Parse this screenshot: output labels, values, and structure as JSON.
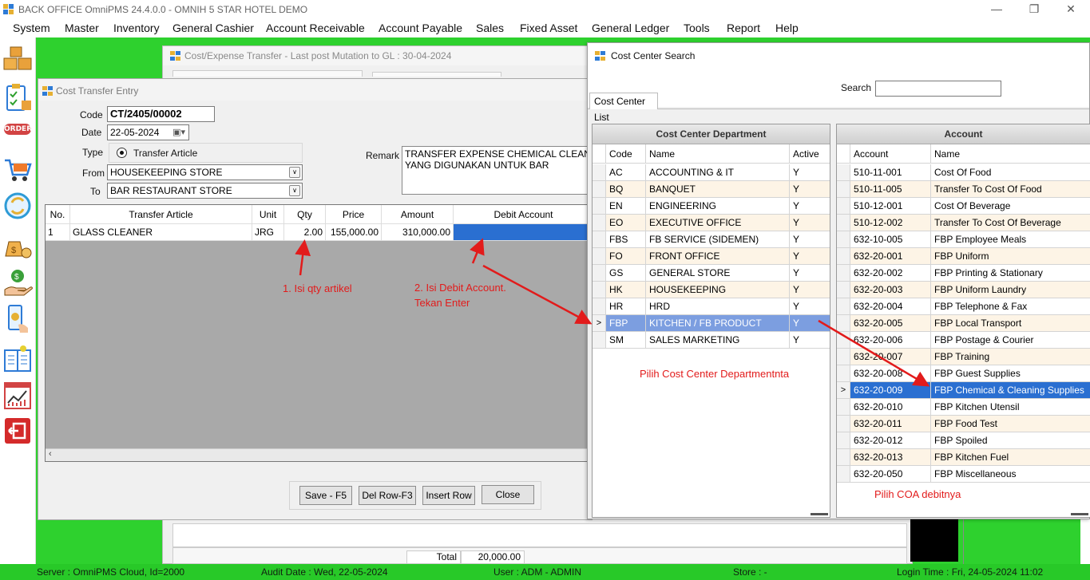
{
  "app": {
    "title": "BACK OFFICE OmniPMS 24.4.0.0 - OMNIH 5 STAR HOTEL DEMO",
    "window_buttons": [
      "—",
      "❐",
      "✕"
    ]
  },
  "menu": [
    "System",
    "Master",
    "Inventory",
    "General Cashier",
    "Account Receivable",
    "Account Payable",
    "Sales",
    "Fixed Asset",
    "General Ledger",
    "Tools",
    "Report",
    "Help"
  ],
  "sidebar_icons": [
    "boxes-icon",
    "clipboard-icon",
    "order-icon",
    "cart-icon",
    "refresh-icon",
    "money-bags-icon",
    "hand-money-icon",
    "mobile-payment-icon",
    "ledger-book-icon",
    "chart-icon",
    "exit-icon"
  ],
  "sidebar_order_label": "ORDER",
  "back_window": {
    "title": "Cost/Expense Transfer - Last post Mutation to GL : 30-04-2024",
    "total_label": "Total",
    "total_value": "20,000.00"
  },
  "entry": {
    "title": "Cost Transfer Entry",
    "code_label": "Code",
    "code_value": "CT/2405/00002",
    "date_label": "Date",
    "date_value": "22-05-2024",
    "type_label": "Type",
    "type_value": "Transfer Article",
    "from_label": "From",
    "from_value": "HOUSEKEEPING STORE",
    "to_label": "To",
    "to_value": "BAR RESTAURANT STORE",
    "remark_label": "Remark",
    "remark_line1": "TRANSFER EXPENSE CHEMICAL CLEANER D",
    "remark_line2": "YANG DIGUNAKAN UNTUK BAR",
    "grid_headers": [
      "No.",
      "Transfer Article",
      "Unit",
      "Qty",
      "Price",
      "Amount",
      "Debit Account"
    ],
    "grid_rows": [
      {
        "no": "1",
        "article": "GLASS CLEANER",
        "unit": "JRG",
        "qty": "2.00",
        "price": "155,000.00",
        "amount": "310,000.00",
        "debit": ""
      }
    ],
    "buttons": {
      "save": "Save - F5",
      "delrow": "Del Row-F3",
      "insert": "Insert Row",
      "close": "Close"
    }
  },
  "annotations": {
    "a1": "1. Isi qty artikel",
    "a2_line1": "2. Isi Debit Account.",
    "a2_line2": "Tekan Enter",
    "a3": "Pilih Cost Center Departmentnta",
    "a4": "Pilih COA debitnya"
  },
  "cc_search": {
    "title": "Cost Center Search",
    "search_label": "Search",
    "search_value": "",
    "tab": "Cost Center List",
    "dept_title": "Cost Center Department",
    "dept_headers": [
      "Code",
      "Name",
      "Active"
    ],
    "departments": [
      {
        "code": "AC",
        "name": "ACCOUNTING & IT",
        "active": "Y"
      },
      {
        "code": "BQ",
        "name": "BANQUET",
        "active": "Y"
      },
      {
        "code": "EN",
        "name": "ENGINEERING",
        "active": "Y"
      },
      {
        "code": "EO",
        "name": "EXECUTIVE OFFICE",
        "active": "Y"
      },
      {
        "code": "FBS",
        "name": "FB SERVICE (SIDEMEN)",
        "active": "Y"
      },
      {
        "code": "FO",
        "name": "FRONT OFFICE",
        "active": "Y"
      },
      {
        "code": "GS",
        "name": "GENERAL STORE",
        "active": "Y"
      },
      {
        "code": "HK",
        "name": "HOUSEKEEPING",
        "active": "Y"
      },
      {
        "code": "HR",
        "name": "HRD",
        "active": "Y"
      },
      {
        "code": "FBP",
        "name": "KITCHEN / FB PRODUCT",
        "active": "Y"
      },
      {
        "code": "SM",
        "name": "SALES MARKETING",
        "active": "Y"
      }
    ],
    "selected_department": 9,
    "acc_title": "Account",
    "acc_headers": [
      "Account",
      "Name"
    ],
    "accounts": [
      {
        "account": "510-11-001",
        "name": "Cost Of Food"
      },
      {
        "account": "510-11-005",
        "name": "Transfer To Cost Of Food"
      },
      {
        "account": "510-12-001",
        "name": "Cost Of Beverage"
      },
      {
        "account": "510-12-002",
        "name": "Transfer To Cost Of Beverage"
      },
      {
        "account": "632-10-005",
        "name": "FBP Employee Meals"
      },
      {
        "account": "632-20-001",
        "name": "FBP Uniform"
      },
      {
        "account": "632-20-002",
        "name": "FBP Printing & Stationary"
      },
      {
        "account": "632-20-003",
        "name": "FBP Uniform Laundry"
      },
      {
        "account": "632-20-004",
        "name": "FBP Telephone & Fax"
      },
      {
        "account": "632-20-005",
        "name": "FBP Local Transport"
      },
      {
        "account": "632-20-006",
        "name": "FBP Postage & Courier"
      },
      {
        "account": "632-20-007",
        "name": "FBP Training"
      },
      {
        "account": "632-20-008",
        "name": "FBP Guest Supplies"
      },
      {
        "account": "632-20-009",
        "name": "FBP Chemical & Cleaning Supplies"
      },
      {
        "account": "632-20-010",
        "name": "FBP Kitchen Utensil"
      },
      {
        "account": "632-20-011",
        "name": "FBP Food Test"
      },
      {
        "account": "632-20-012",
        "name": "FBP Spoiled"
      },
      {
        "account": "632-20-013",
        "name": "FBP Kitchen Fuel"
      },
      {
        "account": "632-20-050",
        "name": "FBP Miscellaneous"
      }
    ],
    "selected_account": 13
  },
  "status": {
    "server": "Server : OmniPMS Cloud, Id=2000",
    "audit": "Audit Date : Wed, 22-05-2024",
    "user": "User : ADM - ADMIN",
    "store": "Store : -",
    "login": "Login Time : Fri, 24-05-2024 11:02"
  },
  "colors": {
    "mdi_green": "#2ed12e",
    "status_green": "#28c928",
    "selection_blue": "#2a6fd1",
    "annotation_red": "#e21b1b"
  }
}
